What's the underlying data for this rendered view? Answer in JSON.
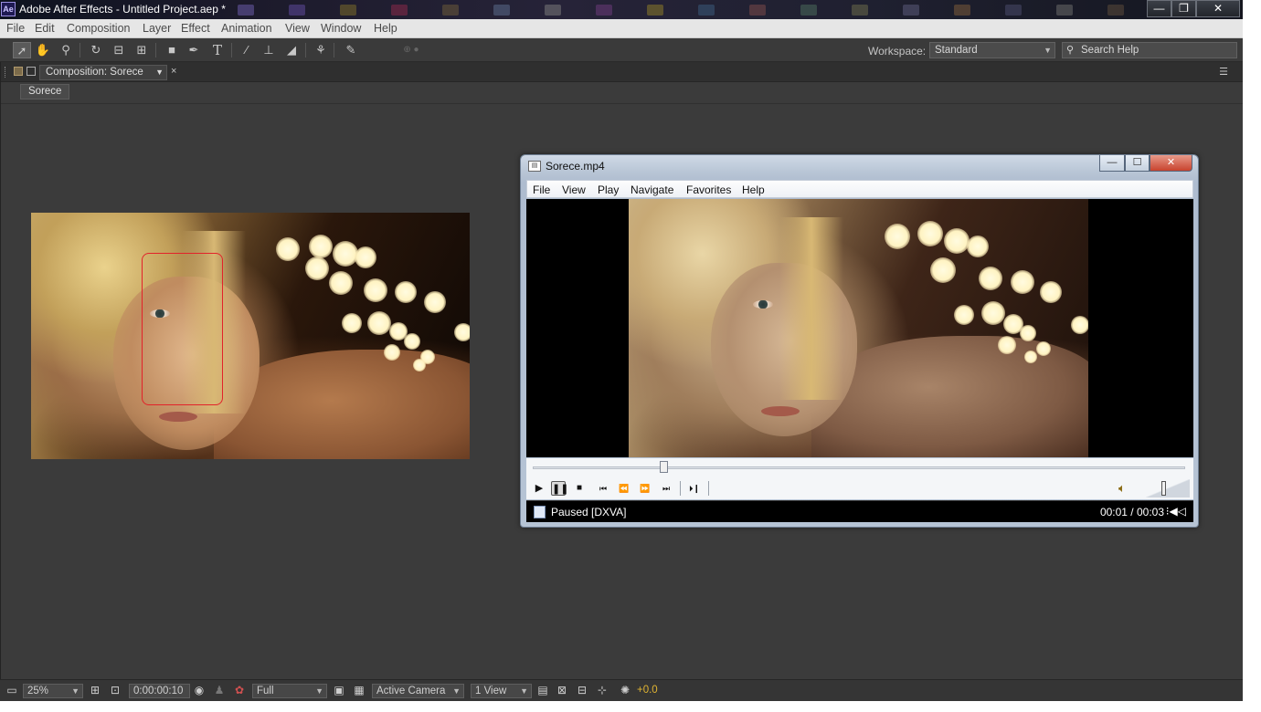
{
  "window": {
    "title": "Adobe After Effects - Untitled Project.aep *",
    "app_icon": "Ae",
    "controls": {
      "minimize": "—",
      "restore": "❐",
      "close": "✕"
    }
  },
  "menu": [
    "File",
    "Edit",
    "Composition",
    "Layer",
    "Effect",
    "Animation",
    "View",
    "Window",
    "Help"
  ],
  "toolbar": {
    "tools": [
      "selection-icon",
      "hand-icon",
      "zoom-icon",
      "rotate-icon",
      "orbit-camera-icon",
      "pan-behind-icon",
      "rectangle-icon",
      "pen-icon",
      "type-icon",
      "brush-icon",
      "clone-stamp-icon",
      "eraser-icon",
      "roto-brush-icon",
      "puppet-pin-icon"
    ],
    "workspace_label": "Workspace:",
    "workspace_value": "Standard",
    "search_placeholder": "Search Help"
  },
  "composition_panel": {
    "tab_label": "Composition: Sorece",
    "close": "×",
    "breadcrumb": "Sorece",
    "mask_color": "#e2222a"
  },
  "player": {
    "title": "Sorece.mp4",
    "menu": [
      "File",
      "View",
      "Play",
      "Navigate",
      "Favorites",
      "Help"
    ],
    "seek_position": 0.2,
    "volume_level": 0.4,
    "controls": [
      "play-icon",
      "pause-icon",
      "stop-icon",
      "previous-icon",
      "rewind-icon",
      "fast-forward-icon",
      "next-icon",
      "frame-step-icon"
    ],
    "status_text": "Paused [DXVA]",
    "time_text": "00:01 / 00:03"
  },
  "bottombar": {
    "zoom": "25%",
    "timecode": "0:00:00:10",
    "resolution": "Full",
    "camera": "Active Camera",
    "views": "1 View",
    "exposure": "+0.0"
  },
  "colors": {
    "ae_panel": "#3b3b3b",
    "exposure": "#e0b432",
    "player_chrome": "#b9c6d6"
  }
}
